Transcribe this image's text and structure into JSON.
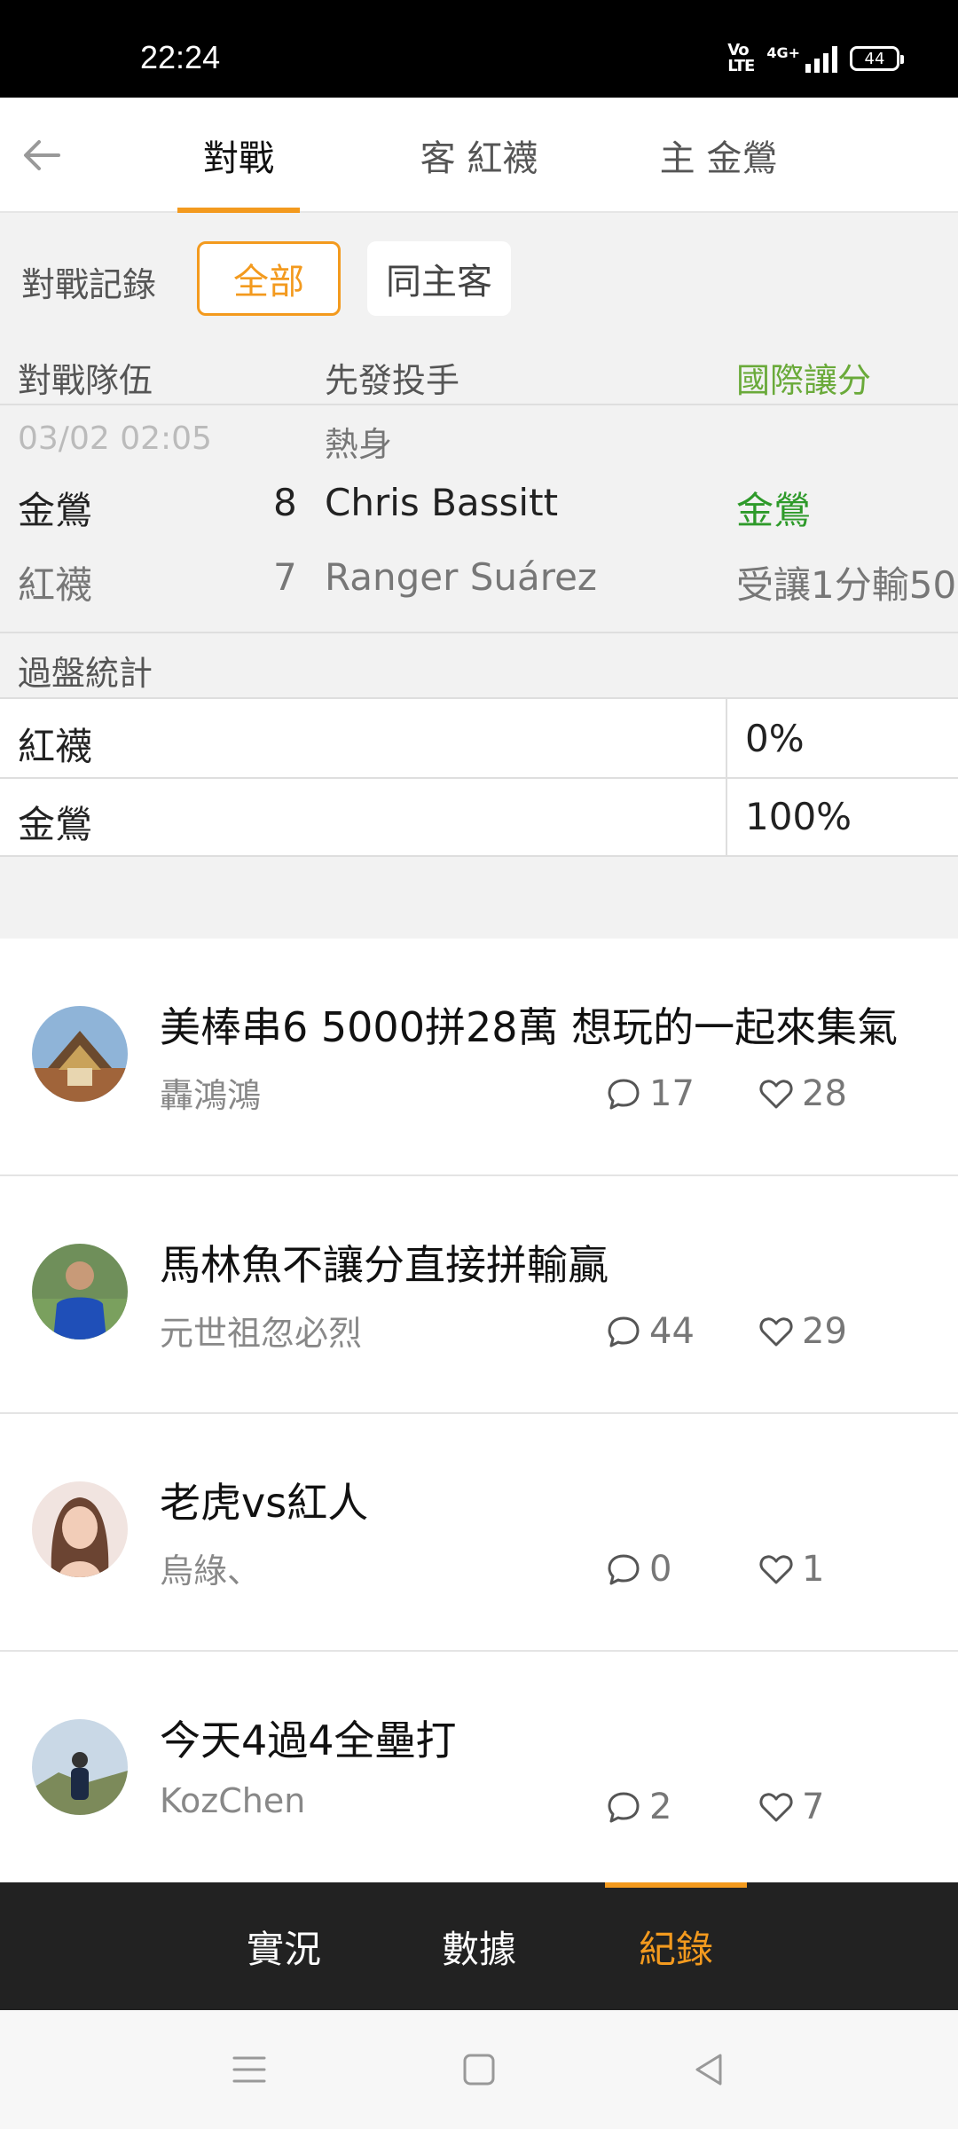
{
  "status_bar": {
    "time": "22:24",
    "volte": "Vo\nLTE",
    "network": "4G+",
    "battery": "44"
  },
  "header": {
    "tabs": [
      {
        "label": "對戰",
        "active": true
      },
      {
        "label": "客 紅襪",
        "active": false
      },
      {
        "label": "主 金鶯",
        "active": false
      }
    ]
  },
  "records": {
    "filter_label": "對戰記錄",
    "filters": [
      {
        "label": "全部",
        "selected": true
      },
      {
        "label": "同主客",
        "selected": false
      }
    ],
    "columns": [
      "對戰隊伍",
      "先發投手",
      "國際讓分"
    ],
    "game": {
      "datetime": "03/02 02:05",
      "type": "熱身",
      "rows": [
        {
          "team": "金鶯",
          "score": "8",
          "pitcher": "Chris Bassitt",
          "handicap": "金鶯"
        },
        {
          "team": "紅襪",
          "score": "7",
          "pitcher": "Ranger Suárez",
          "handicap": "受讓1分輸50"
        }
      ]
    },
    "stats": {
      "title": "過盤統計",
      "rows": [
        {
          "team": "紅襪",
          "value": "0%"
        },
        {
          "team": "金鶯",
          "value": "100%"
        }
      ]
    }
  },
  "posts": [
    {
      "title": "美棒串6 5000拼28萬 想玩的一起來集氣",
      "author": "轟鴻鴻",
      "comments": "17",
      "likes": "28"
    },
    {
      "title": "馬林魚不讓分直接拼輸贏",
      "author": "元世祖忽必烈",
      "comments": "44",
      "likes": "29"
    },
    {
      "title": "老虎vs紅人",
      "author": "烏綠、",
      "comments": "0",
      "likes": "1"
    },
    {
      "title": "今天4過4全壘打",
      "author": "KozChen",
      "comments": "2",
      "likes": "7"
    }
  ],
  "bottom_tabs": [
    {
      "label": "實況",
      "active": false
    },
    {
      "label": "數據",
      "active": false
    },
    {
      "label": "紀錄",
      "active": true
    }
  ],
  "colors": {
    "accent": "#f39a1e",
    "green": "#2e9a2a",
    "bottom_bar": "#222222"
  }
}
